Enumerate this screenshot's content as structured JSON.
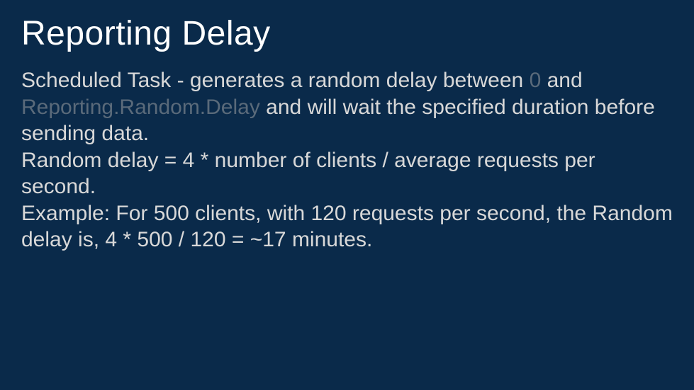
{
  "title": "Reporting Delay",
  "body": {
    "p1_a": "Scheduled Task - generates a random delay between ",
    "p1_zero": "0",
    "p1_b": " and ",
    "p1_param": "Reporting.Random.Delay",
    "p1_c": " and will wait the specified duration before sending data.",
    "p2": "Random delay = 4 * number of clients / average requests per second.",
    "p3": "Example: For 500 clients, with 120 requests per second, the Random delay is, 4 * 500 / 120 = ~17 minutes."
  }
}
